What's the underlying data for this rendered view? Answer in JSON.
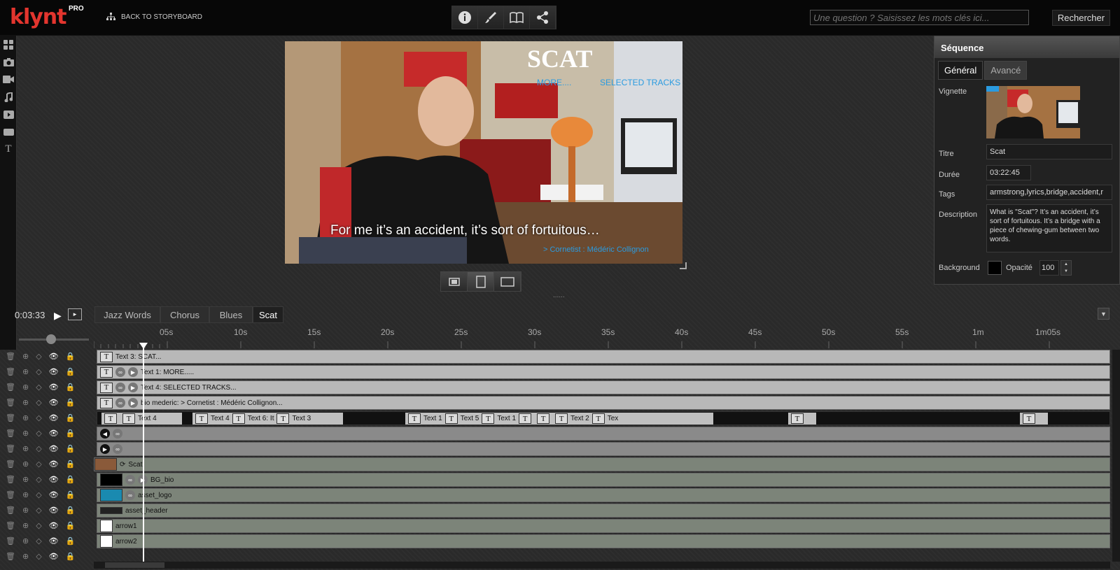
{
  "app": {
    "logo": "klynt",
    "logo_badge": "PRO",
    "back_label": "BACK TO STORYBOARD"
  },
  "toolbar": {
    "icons": [
      "info-icon",
      "brush-icon",
      "book-icon",
      "share-icon"
    ]
  },
  "search": {
    "placeholder": "Une question ? Saisissez les mots clés ici...",
    "button": "Rechercher"
  },
  "left_toolbar": [
    "grid-icon",
    "camera-icon",
    "video-icon",
    "music-icon",
    "play-icon",
    "rect-icon",
    "text-icon"
  ],
  "preview": {
    "title": "SCAT",
    "link_more": "MORE....",
    "link_selected": "SELECTED TRACKS",
    "subtitle": "For me it’s an accident, it’s sort of fortuitous…",
    "bio": "> Cornetist : Médéric Collignon"
  },
  "properties": {
    "header": "Séquence",
    "tabs": [
      "Général",
      "Avancé"
    ],
    "vignette_label": "Vignette",
    "titre_label": "Titre",
    "titre": "Scat",
    "duree_label": "Durée",
    "duree": "03:22:45",
    "tags_label": "Tags",
    "tags": "armstrong,lyrics,bridge,accident,r",
    "description_label": "Description",
    "description": "What is \"Scat\"? It’s an accident, it’s sort of fortuitous. It’s a bridge with a piece of chewing-gum between two words.",
    "background_label": "Background",
    "background_color": "#000000",
    "opacite_label": "Opacité",
    "opacite": "100"
  },
  "timeline": {
    "time": "0:03:33",
    "sequence_tabs": [
      "Jazz Words",
      "Chorus",
      "Blues",
      "Scat"
    ],
    "active_tab": "Scat",
    "ruler": [
      "05s",
      "10s",
      "15s",
      "20s",
      "25s",
      "30s",
      "35s",
      "40s",
      "45s",
      "50s",
      "55s",
      "1m",
      "1m05s"
    ],
    "tracks": [
      {
        "label": "Text 3:  SCAT...",
        "kind": "text",
        "icons": [
          "T"
        ]
      },
      {
        "label": "Text 1:  MORE.....",
        "kind": "text",
        "icons": [
          "T",
          "link",
          "play"
        ]
      },
      {
        "label": "Text 4:  SELECTED TRACKS...",
        "kind": "text",
        "icons": [
          "T",
          "link",
          "play"
        ]
      },
      {
        "label": "bio mederic:  > Cornetist : Médéric Collignon...",
        "kind": "text",
        "icons": [
          "T",
          "link",
          "play"
        ]
      },
      {
        "label": "",
        "kind": "multi",
        "clips": [
          "Text 4",
          "Text 4",
          "Text 6:  It",
          "Text 3",
          "Text 1",
          "Text 5",
          "Text 1",
          "Text 2",
          "Tex"
        ]
      },
      {
        "label": "",
        "kind": "nav",
        "icons": [
          "prev",
          "link"
        ]
      },
      {
        "label": "",
        "kind": "nav",
        "icons": [
          "next",
          "link"
        ]
      },
      {
        "label": "Scat",
        "kind": "video",
        "thumb": "video"
      },
      {
        "label": "BG_bio",
        "kind": "asset",
        "thumb": "black"
      },
      {
        "label": "asset_logo",
        "kind": "asset",
        "thumb": "logo"
      },
      {
        "label": "asset_header",
        "kind": "asset",
        "thumb": "header"
      },
      {
        "label": "arrow1",
        "kind": "asset",
        "thumb": "white"
      },
      {
        "label": "arrow2",
        "kind": "asset",
        "thumb": "white"
      }
    ]
  }
}
